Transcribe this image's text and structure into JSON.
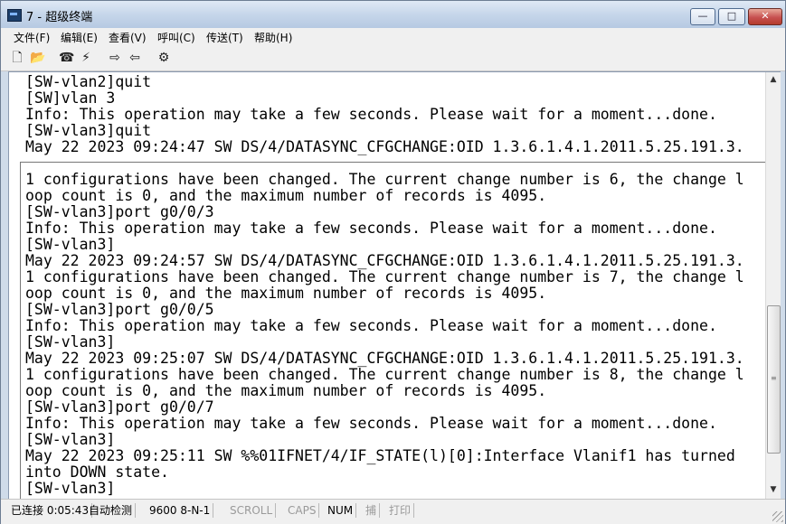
{
  "window": {
    "title": "7 - 超级终端",
    "minimize": "—",
    "maximize": "□",
    "close": "✕"
  },
  "menu": [
    "文件(F)",
    "编辑(E)",
    "查看(V)",
    "呼叫(C)",
    "传送(T)",
    "帮助(H)"
  ],
  "toolbar": [
    {
      "icon": "new-file-icon",
      "glyph": "🗋"
    },
    {
      "icon": "open-folder-icon",
      "glyph": "📂"
    },
    {
      "icon": "phone-icon",
      "glyph": "☎"
    },
    {
      "icon": "disconnect-icon",
      "glyph": "⚡"
    },
    {
      "icon": "send-icon",
      "glyph": "⇨"
    },
    {
      "icon": "receive-icon",
      "glyph": "⇦"
    },
    {
      "icon": "properties-icon",
      "glyph": "⚙"
    }
  ],
  "upper_lines": [
    "[SW-vlan2]quit",
    "[SW]vlan 3",
    "Info: This operation may take a few seconds. Please wait for a moment...done.",
    "[SW-vlan3]quit",
    "May 22 2023 09:24:47 SW DS/4/DATASYNC_CFGCHANGE:OID 1.3.6.1.4.1.2011.5.25.191.3."
  ],
  "lower_lines": [
    "1 configurations have been changed. The current change number is 6, the change l",
    "oop count is 0, and the maximum number of records is 4095.",
    "[SW-vlan3]port g0/0/3",
    "Info: This operation may take a few seconds. Please wait for a moment...done.",
    "[SW-vlan3]",
    "May 22 2023 09:24:57 SW DS/4/DATASYNC_CFGCHANGE:OID 1.3.6.1.4.1.2011.5.25.191.3.",
    "1 configurations have been changed. The current change number is 7, the change l",
    "oop count is 0, and the maximum number of records is 4095.",
    "[SW-vlan3]port g0/0/5",
    "Info: This operation may take a few seconds. Please wait for a moment...done.",
    "[SW-vlan3]",
    "May 22 2023 09:25:07 SW DS/4/DATASYNC_CFGCHANGE:OID 1.3.6.1.4.1.2011.5.25.191.3.",
    "1 configurations have been changed. The current change number is 8, the change l",
    "oop count is 0, and the maximum number of records is 4095.",
    "[SW-vlan3]port g0/0/7",
    "Info: This operation may take a few seconds. Please wait for a moment...done.",
    "[SW-vlan3]",
    "May 22 2023 09:25:11 SW %%01IFNET/4/IF_STATE(l)[0]:Interface Vlanif1 has turned",
    "into DOWN state.",
    "[SW-vlan3]"
  ],
  "scrollbar": {
    "up": "▲",
    "down": "▼",
    "grip": "≡"
  },
  "status": [
    {
      "text": "已连接 0:05:43",
      "active": true
    },
    {
      "text": "自动检测",
      "active": true
    },
    {
      "text": "9600 8-N-1",
      "active": true
    },
    {
      "text": "SCROLL",
      "active": false
    },
    {
      "text": "CAPS",
      "active": false
    },
    {
      "text": "NUM",
      "active": true
    },
    {
      "text": "捕",
      "active": false
    },
    {
      "text": "打印",
      "active": false
    }
  ]
}
